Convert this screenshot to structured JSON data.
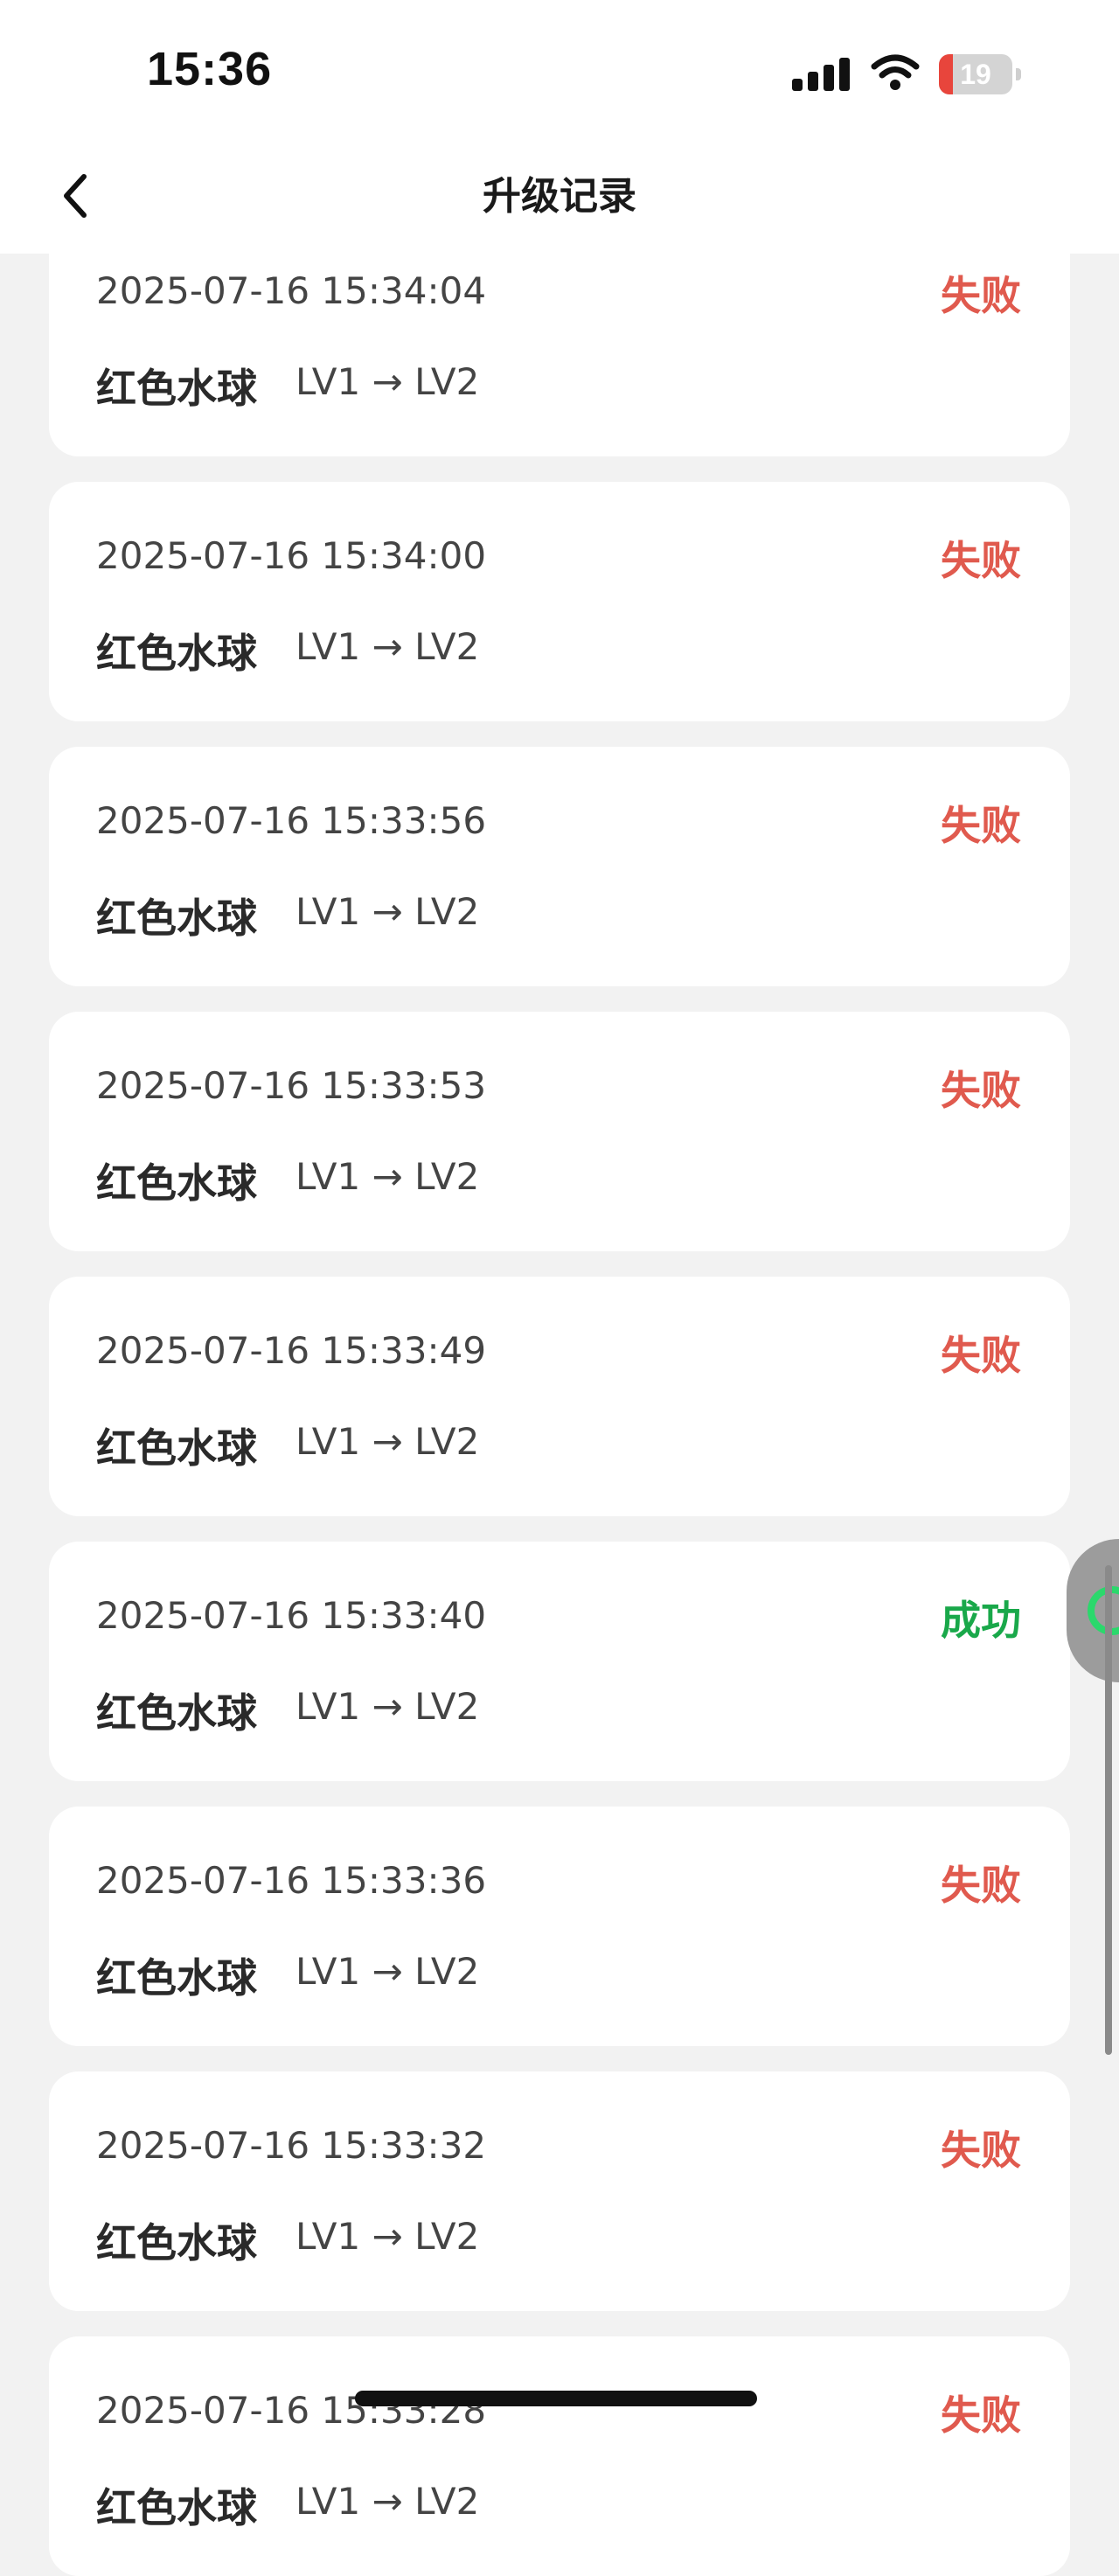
{
  "status_bar": {
    "time": "15:36",
    "battery_level": "19",
    "battery_fraction": 0.19
  },
  "header": {
    "back_icon": "chevron-left-icon",
    "title": "升级记录"
  },
  "colors": {
    "fail": "#e05a4e",
    "success": "#19a84a",
    "card": "#ffffff",
    "background": "#f2f2f2"
  },
  "records": [
    {
      "time": "2025-07-16 15:34:04",
      "status": "失败",
      "result": "fail",
      "item": "红色水球",
      "levels": "LV1 → LV2"
    },
    {
      "time": "2025-07-16 15:34:00",
      "status": "失败",
      "result": "fail",
      "item": "红色水球",
      "levels": "LV1 → LV2"
    },
    {
      "time": "2025-07-16 15:33:56",
      "status": "失败",
      "result": "fail",
      "item": "红色水球",
      "levels": "LV1 → LV2"
    },
    {
      "time": "2025-07-16 15:33:53",
      "status": "失败",
      "result": "fail",
      "item": "红色水球",
      "levels": "LV1 → LV2"
    },
    {
      "time": "2025-07-16 15:33:49",
      "status": "失败",
      "result": "fail",
      "item": "红色水球",
      "levels": "LV1 → LV2"
    },
    {
      "time": "2025-07-16 15:33:40",
      "status": "成功",
      "result": "success",
      "item": "红色水球",
      "levels": "LV1 → LV2"
    },
    {
      "time": "2025-07-16 15:33:36",
      "status": "失败",
      "result": "fail",
      "item": "红色水球",
      "levels": "LV1 → LV2"
    },
    {
      "time": "2025-07-16 15:33:32",
      "status": "失败",
      "result": "fail",
      "item": "红色水球",
      "levels": "LV1 → LV2"
    },
    {
      "time": "2025-07-16 15:33:28",
      "status": "失败",
      "result": "fail",
      "item": "红色水球",
      "levels": "LV1 → LV2"
    }
  ]
}
